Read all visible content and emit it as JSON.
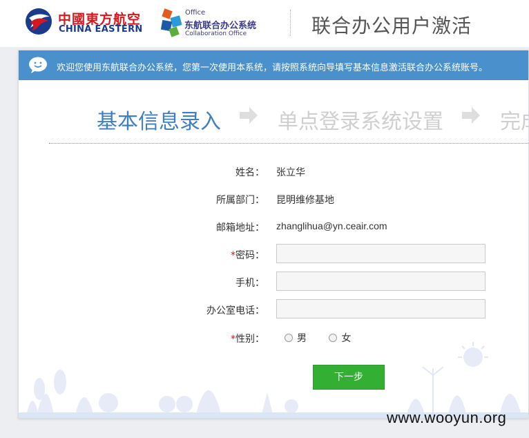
{
  "header": {
    "brand_cn": "中國東方航空",
    "brand_en": "CHINA EASTERN",
    "oa_small": "Office",
    "oa_cn": "东航联合办公系统",
    "oa_collab": "Collaboration Office",
    "page_title": "联合办公用户激活"
  },
  "welcome": {
    "text": "欢迎您使用东航联合办公系统，您第一次使用本系统，请按照系统向导填写基本信息激活联合办公系统账号。"
  },
  "steps": [
    {
      "label": "基本信息录入",
      "state": "active"
    },
    {
      "label": "单点登录系统设置",
      "state": "inactive"
    },
    {
      "label": "完成",
      "state": "inactive"
    }
  ],
  "form": {
    "name_label": "姓名：",
    "name_value": "张立华",
    "dept_label": "所属部门：",
    "dept_value": "昆明维修基地",
    "email_label": "邮箱地址：",
    "email_value": "zhanglihua@yn.ceair.com",
    "required_mark": "*",
    "password_label": "密码：",
    "password_value": "",
    "mobile_label": "手机：",
    "mobile_value": "",
    "office_phone_label": "办公室电话：",
    "office_phone_value": "",
    "gender_label": "性别：",
    "gender_options": [
      "男",
      "女"
    ]
  },
  "actions": {
    "next_label": "下一步"
  },
  "watermark": "www.wooyun.org",
  "colors": {
    "accent_blue": "#4a90cc",
    "step_active": "#3f7fc0",
    "button_green": "#33b034",
    "brand_red": "#d8161f"
  }
}
